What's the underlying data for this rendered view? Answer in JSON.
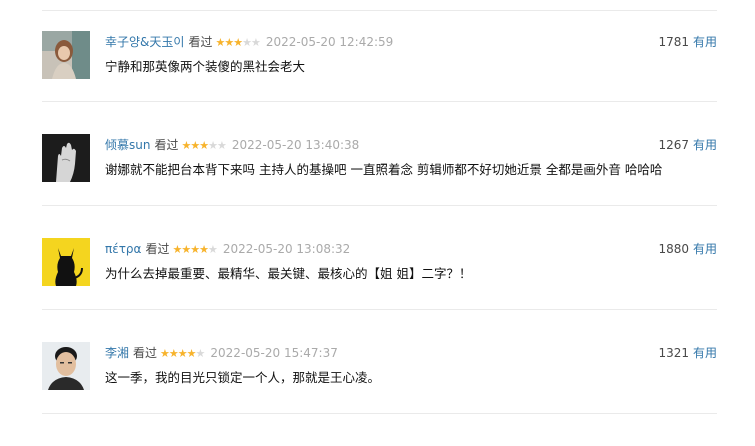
{
  "colors": {
    "link": "#3377aa",
    "star_on": "#f7b32c",
    "star_off": "#d9d9d9",
    "time": "#aaaaaa",
    "divider": "#eaeaea"
  },
  "comments": [
    {
      "author": "幸子양&天玉이",
      "status": "看过",
      "rating": 3,
      "time": "2022-05-20 12:42:59",
      "votes": "1781",
      "vote_label": "有用",
      "text": "宁静和那英像两个装傻的黑社会老大",
      "avatar": "girl-photo-avatar"
    },
    {
      "author": "倾慕sun",
      "status": "看过",
      "rating": 3,
      "time": "2022-05-20 13:40:38",
      "votes": "1267",
      "vote_label": "有用",
      "text": "谢娜就不能把台本背下来吗 主持人的基操吧 一直照着念 剪辑师都不好切她近景 全都是画外音 哈哈哈",
      "avatar": "hand-photo-avatar"
    },
    {
      "author": "πέτρα",
      "status": "看过",
      "rating": 4,
      "time": "2022-05-20 13:08:32",
      "votes": "1880",
      "vote_label": "有用",
      "text": "为什么去掉最重要、最精华、最关键、最核心的【姐 姐】二字？！",
      "avatar": "devil-silhouette-avatar"
    },
    {
      "author": "李湘",
      "status": "看过",
      "rating": 4,
      "time": "2022-05-20 15:47:37",
      "votes": "1321",
      "vote_label": "有用",
      "text": "这一季，我的目光只锁定一个人，那就是王心凌。",
      "avatar": "man-portrait-avatar"
    }
  ]
}
